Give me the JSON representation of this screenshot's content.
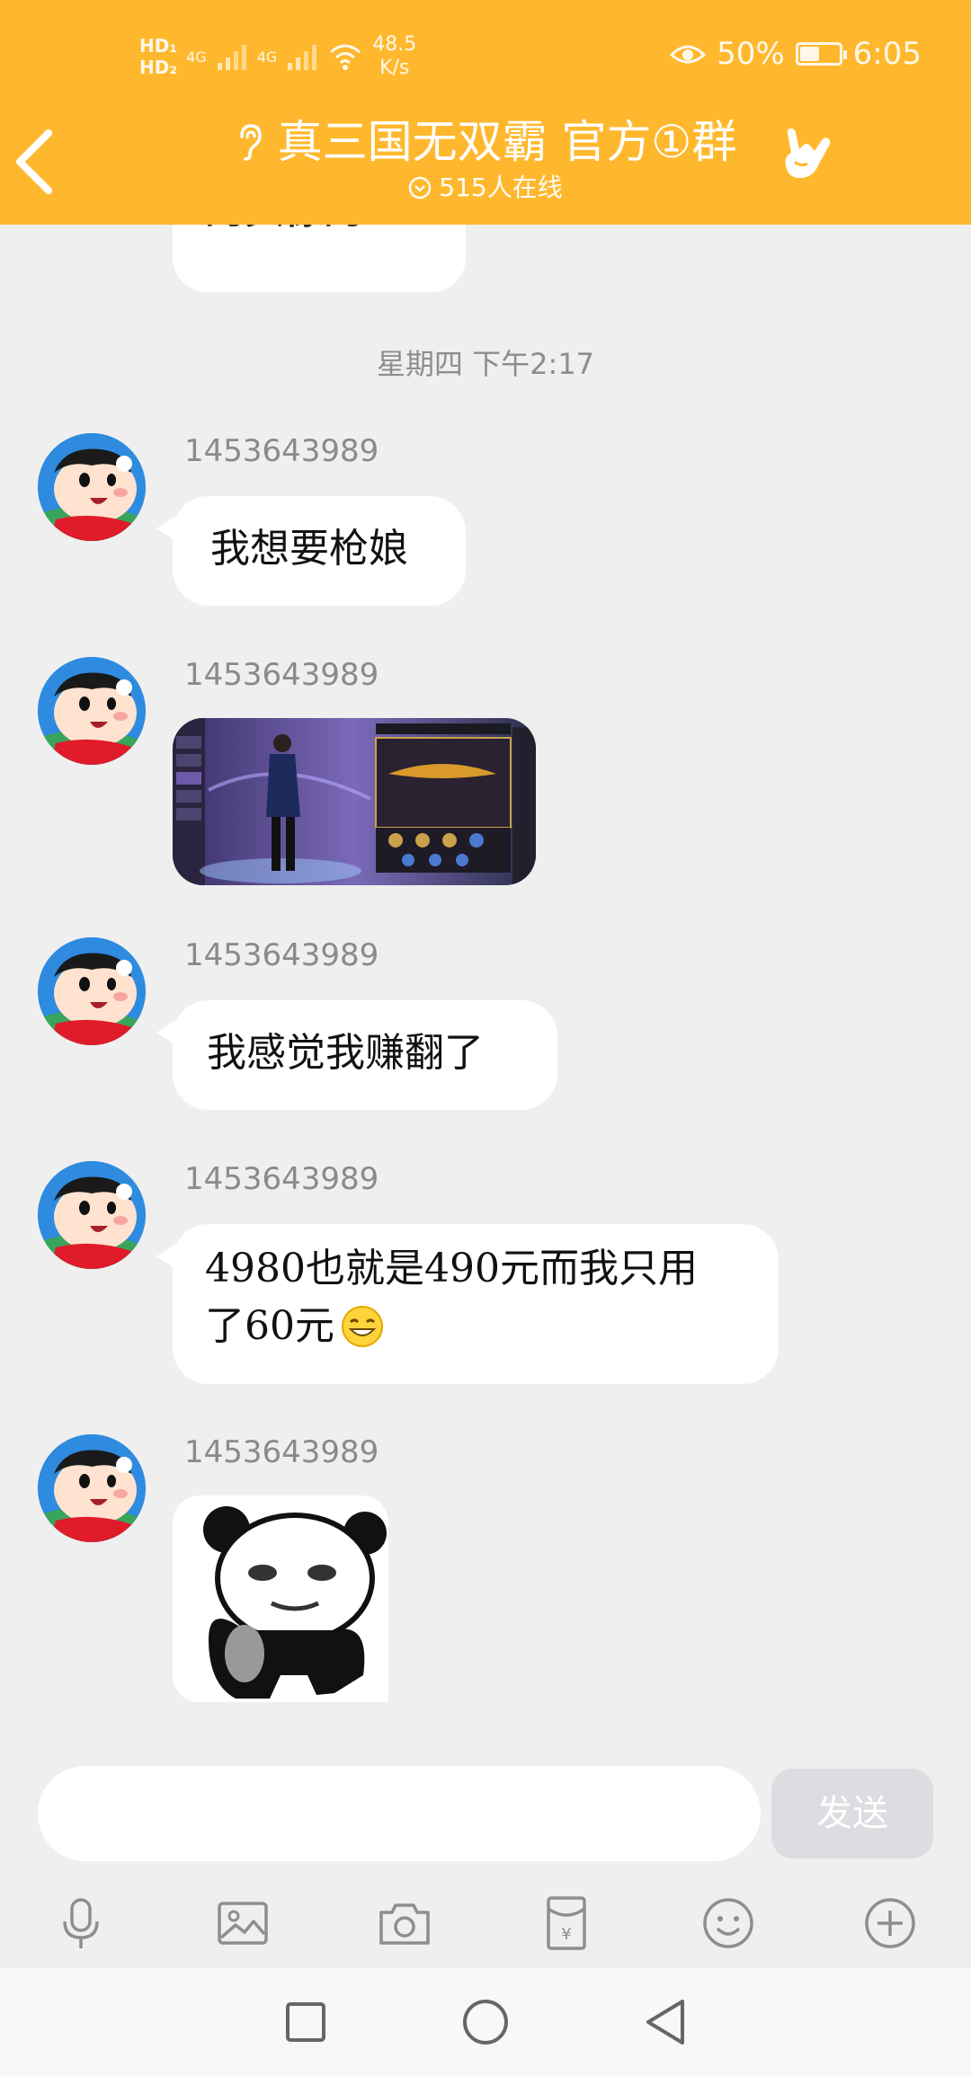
{
  "status_bar": {
    "hd1": "HD₁",
    "hd2": "HD₂",
    "signal1": "4G",
    "signal2": "4G",
    "net_speed": "48.5",
    "net_unit": "K/s",
    "battery": "50%",
    "battery_level": 0.5,
    "time": "6:05"
  },
  "header": {
    "title": "真三国无双霸 官方①群",
    "online": "515人在线",
    "accent": "#ffb82e"
  },
  "chat": {
    "partial_text": "的头像的",
    "timestamp": "星期四 下午2:17",
    "messages": [
      {
        "sender": "1453643989",
        "type": "text",
        "text": "我想要枪娘"
      },
      {
        "sender": "1453643989",
        "type": "image",
        "alt": "game-screenshot"
      },
      {
        "sender": "1453643989",
        "type": "text",
        "text": "我感觉我赚翻了"
      },
      {
        "sender": "1453643989",
        "type": "text",
        "line1": "4980也就是490元而我只用",
        "line2": "了60元",
        "emoji": "grin-emoji"
      },
      {
        "sender": "1453643989",
        "type": "sticker",
        "alt": "panda-meme-sticker"
      }
    ]
  },
  "composer": {
    "placeholder": "",
    "send_label": "发送"
  },
  "toolbar": {
    "items": [
      "mic-icon",
      "image-icon",
      "camera-icon",
      "red-packet-icon",
      "emoji-icon",
      "plus-icon"
    ]
  },
  "navbar": {
    "items": [
      "recent-apps-icon",
      "home-icon",
      "back-triangle-icon"
    ]
  }
}
